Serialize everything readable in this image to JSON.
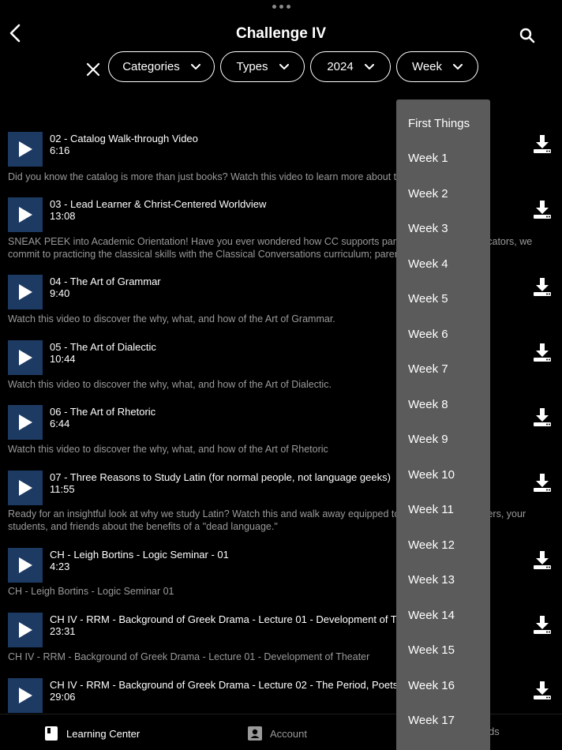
{
  "header": {
    "title": "Challenge IV"
  },
  "filters": {
    "categories": "Categories",
    "types": "Types",
    "year": "2024",
    "week": "Week"
  },
  "videos": [
    {
      "title": "02 - Catalog Walk-through Video",
      "duration": "6:16",
      "description": "Did you know the catalog is more than just books? Watch this video to learn more about the catalog!"
    },
    {
      "title": "03 - Lead Learner & Christ-Centered Worldview",
      "duration": "13:08",
      "description": "SNEAK PEEK into Academic Orientation! Have you ever wondered how CC supports parents as classical educators, we commit to practicing the classical skills with the Classical Conversations curriculum; parent..."
    },
    {
      "title": "04 - The Art of Grammar",
      "duration": "9:40",
      "description": "Watch this video to discover the why, what, and how of the Art of Grammar."
    },
    {
      "title": "05 - The Art of Dialectic",
      "duration": "10:44",
      "description": "Watch this video to discover the why, what, and how of the Art of Dialectic."
    },
    {
      "title": "06 - The Art of Rhetoric",
      "duration": "6:44",
      "description": "Watch this video to discover the why, what, and how of the Art of Rhetoric"
    },
    {
      "title": "07 - Three Reasons to Study Latin (for normal people, not language geeks)",
      "duration": "11:55",
      "description": "Ready for an insightful look at why we study Latin? Watch this and walk away equipped to talk to family members, your students, and friends about the benefits of a \"dead language.\""
    },
    {
      "title": "CH - Leigh Bortins - Logic Seminar - 01",
      "duration": "4:23",
      "description": "CH - Leigh Bortins - Logic Seminar 01"
    },
    {
      "title": "CH IV - RRM - Background of Greek Drama - Lecture 01 - Development of Theater",
      "duration": "23:31",
      "description": "CH IV - RRM - Background of Greek Drama - Lecture 01 - Development of Theater"
    },
    {
      "title": "CH IV - RRM - Background of Greek Drama - Lecture 02 - The Period, Poets",
      "duration": "29:06",
      "description": ""
    }
  ],
  "week_dropdown": {
    "options": [
      "First Things",
      "Week 1",
      "Week 2",
      "Week 3",
      "Week 4",
      "Week 5",
      "Week 6",
      "Week 7",
      "Week 8",
      "Week 9",
      "Week 10",
      "Week 11",
      "Week 12",
      "Week 13",
      "Week 14",
      "Week 15",
      "Week 16",
      "Week 17"
    ]
  },
  "tabbar": {
    "learning_center": "Learning Center",
    "account": "Account",
    "downloads_partial": "ds"
  },
  "colors": {
    "background": "#000000",
    "thumbnail": "#1d3a63",
    "dropdown": "#5b5b5b",
    "muted_text": "#9a9a9a"
  },
  "icons": [
    "back-chevron-icon",
    "search-icon",
    "close-icon",
    "chevron-down-icon",
    "play-icon",
    "download-icon",
    "book-icon",
    "account-icon"
  ]
}
